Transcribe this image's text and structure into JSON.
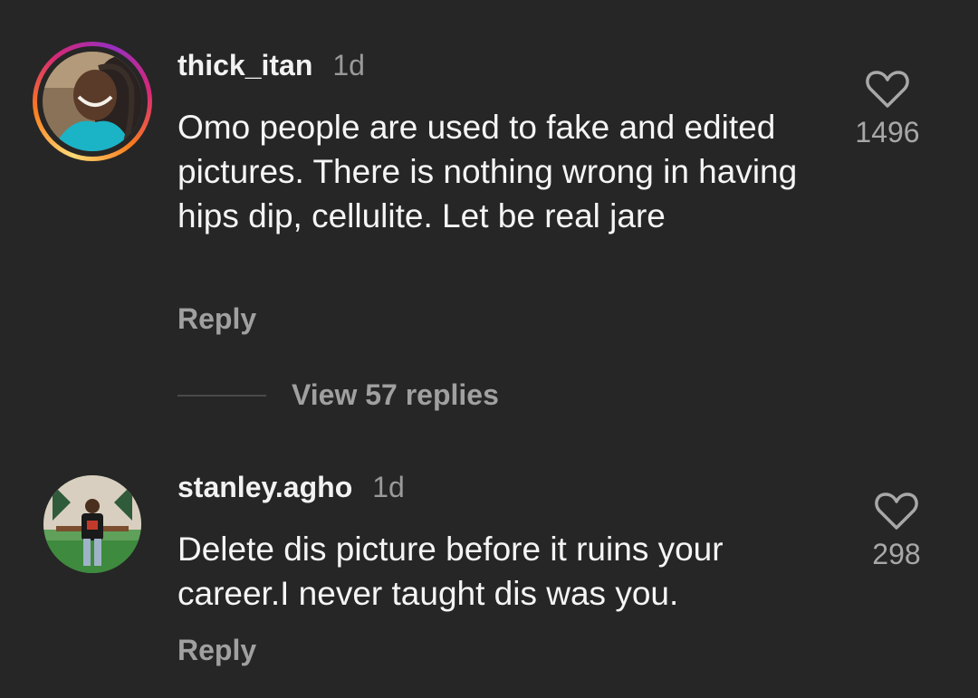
{
  "comments": [
    {
      "username": "thick_itan",
      "age": "1d",
      "text": "Omo people are used to fake and edited pictures. There is nothing wrong in having hips dip, cellulite. Let be real jare",
      "reply_label": "Reply",
      "like_count": "1496",
      "like_icon": "heart-outline-icon",
      "has_story_ring": true
    },
    {
      "username": "stanley.agho",
      "age": "1d",
      "text": "Delete dis picture before it ruins your career.I never taught dis was you.",
      "reply_label": "Reply",
      "like_count": "298",
      "like_icon": "heart-outline-icon",
      "has_story_ring": false
    }
  ],
  "view_replies": {
    "label": "View 57 replies"
  },
  "colors": {
    "background": "#262626",
    "primary_text": "#f2f2f2",
    "secondary_text": "#a0a0a0"
  }
}
